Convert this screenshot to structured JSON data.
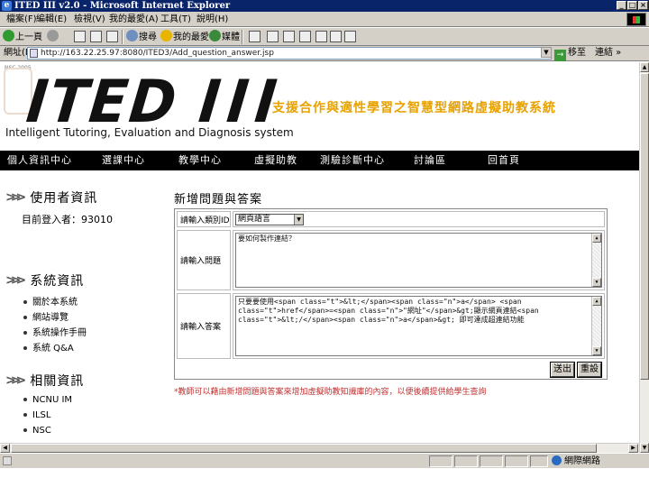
{
  "window": {
    "title": "ITED III v2.0 - Microsoft Internet Explorer",
    "minimize": "_",
    "maximize": "□",
    "close": "×"
  },
  "menu": [
    "檔案(F)",
    "編輯(E)",
    "檢視(V)",
    "我的最愛(A)",
    "工具(T)",
    "說明(H)"
  ],
  "toolbar": {
    "back": "上一頁",
    "search": "搜尋",
    "favorites": "我的最愛",
    "media": "媒體"
  },
  "address": {
    "label": "網址(D)",
    "url": "http://163.22.25.97:8080/ITED3/Add_question_answer.jsp",
    "go": "移至",
    "links": "連結 »"
  },
  "page": {
    "nsc_tag": "NSC 2005",
    "logo_text": "ITED",
    "logo_roman": "III",
    "subtitle_cn": "支援合作與適性學習之智慧型網路虛擬助教系統",
    "subtitle_en": "Intelligent Tutoring, Evaluation and Diagnosis system"
  },
  "nav": [
    "個人資訊中心",
    "選課中心",
    "教學中心",
    "虛擬助教",
    "測驗診斷中心",
    "討論區",
    "回首頁"
  ],
  "sidebar": {
    "user_info": {
      "heading": "使用者資訊",
      "current_user": "目前登入者：93010"
    },
    "system_info": {
      "heading": "系統資訊",
      "links": [
        "關於本系統",
        "網站導覽",
        "系統操作手冊",
        "系統 Q&A"
      ]
    },
    "related_info": {
      "heading": "相關資訊",
      "links": [
        "NCNU IM",
        "ILSL",
        "NSC"
      ]
    }
  },
  "form": {
    "title": "新增問題與答案",
    "category_label": "請輸入類別ID",
    "category_value": "網頁語言",
    "question_label": "請輸入問題",
    "question_value": "要如何製作連結？",
    "answer_label": "請輸入答案",
    "answer_value": "只要要使用<span class=\"t\">&lt;</span><span class=\"n\">a</span> <span class=\"t\">href</span>=<span class=\"n\">\"網址\"</span>&gt;顯示網頁連結<span class=\"t\">&lt;/</span><span class=\"n\">a</span>&gt; 即可達成超連結功能",
    "submit": "送出",
    "reset": "重設",
    "note": "*教師可以藉由新增問題與答案來增加虛擬助教知識庫的內容，以便後續提供給學生查詢"
  },
  "status": {
    "zone": "網際網路"
  }
}
